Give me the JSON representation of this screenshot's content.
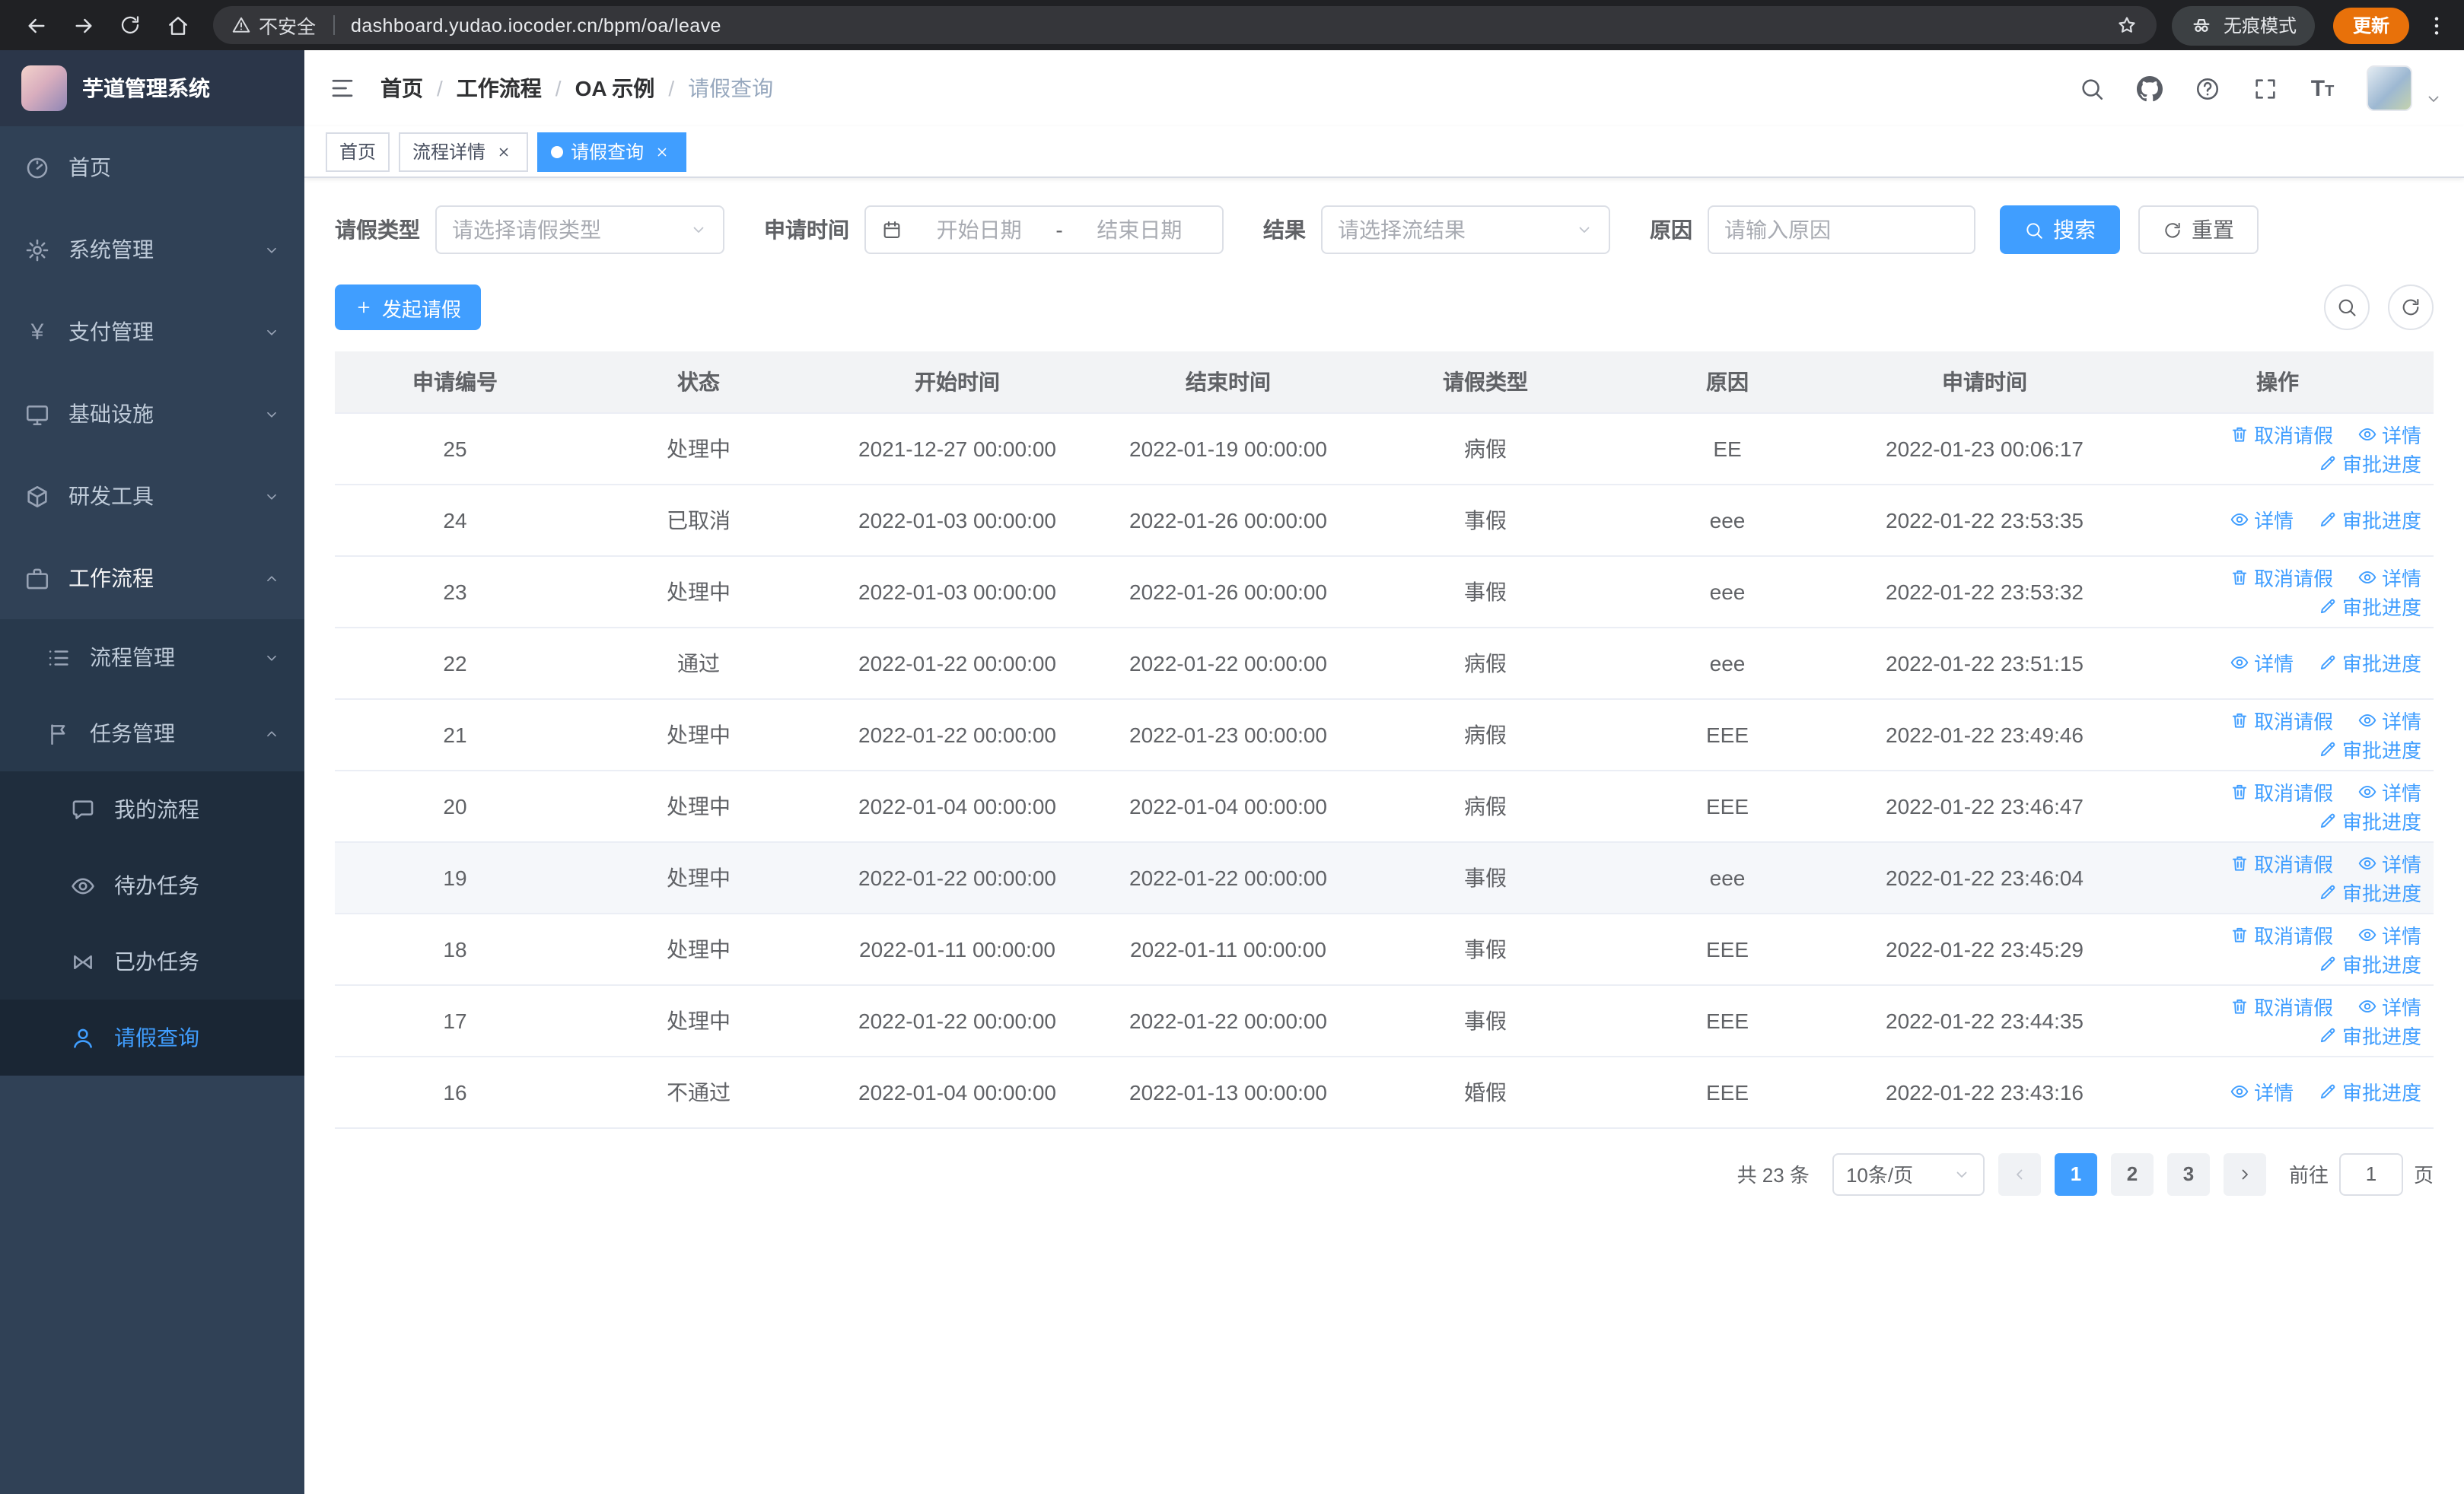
{
  "browser": {
    "security_label": "不安全",
    "url": "dashboard.yudao.iocoder.cn/bpm/oa/leave",
    "incognito_label": "无痕模式",
    "update_label": "更新"
  },
  "sidebar": {
    "title": "芋道管理系统",
    "top": [
      {
        "label": "首页"
      },
      {
        "label": "系统管理"
      },
      {
        "label": "支付管理"
      },
      {
        "label": "基础设施"
      },
      {
        "label": "研发工具"
      },
      {
        "label": "工作流程"
      }
    ],
    "workflow_children": [
      {
        "label": "流程管理"
      },
      {
        "label": "任务管理"
      }
    ],
    "task_children": [
      {
        "label": "我的流程"
      },
      {
        "label": "待办任务"
      },
      {
        "label": "已办任务"
      },
      {
        "label": "请假查询"
      }
    ]
  },
  "header": {
    "breadcrumb": [
      "首页",
      "工作流程",
      "OA 示例",
      "请假查询"
    ]
  },
  "tabs": [
    {
      "label": "首页",
      "closable": false,
      "active": false
    },
    {
      "label": "流程详情",
      "closable": true,
      "active": false
    },
    {
      "label": "请假查询",
      "closable": true,
      "active": true
    }
  ],
  "filters": {
    "leave_type_label": "请假类型",
    "leave_type_placeholder": "请选择请假类型",
    "apply_time_label": "申请时间",
    "start_date_placeholder": "开始日期",
    "range_separator": "-",
    "end_date_placeholder": "结束日期",
    "result_label": "结果",
    "result_placeholder": "请选择流结果",
    "reason_label": "原因",
    "reason_placeholder": "请输入原因",
    "search_button": "搜索",
    "reset_button": "重置"
  },
  "toolbar": {
    "create_button": "发起请假"
  },
  "table": {
    "columns": [
      "申请编号",
      "状态",
      "开始时间",
      "结束时间",
      "请假类型",
      "原因",
      "申请时间",
      "操作"
    ],
    "actions": {
      "cancel": "取消请假",
      "detail": "详情",
      "progress": "审批进度"
    },
    "rows": [
      {
        "id": "25",
        "status": "处理中",
        "start": "2021-12-27 00:00:00",
        "end": "2022-01-19 00:00:00",
        "type": "病假",
        "reason": "EE",
        "applied": "2022-01-23 00:06:17",
        "can_cancel": true,
        "hover": false
      },
      {
        "id": "24",
        "status": "已取消",
        "start": "2022-01-03 00:00:00",
        "end": "2022-01-26 00:00:00",
        "type": "事假",
        "reason": "eee",
        "applied": "2022-01-22 23:53:35",
        "can_cancel": false,
        "hover": false
      },
      {
        "id": "23",
        "status": "处理中",
        "start": "2022-01-03 00:00:00",
        "end": "2022-01-26 00:00:00",
        "type": "事假",
        "reason": "eee",
        "applied": "2022-01-22 23:53:32",
        "can_cancel": true,
        "hover": false
      },
      {
        "id": "22",
        "status": "通过",
        "start": "2022-01-22 00:00:00",
        "end": "2022-01-22 00:00:00",
        "type": "病假",
        "reason": "eee",
        "applied": "2022-01-22 23:51:15",
        "can_cancel": false,
        "hover": false
      },
      {
        "id": "21",
        "status": "处理中",
        "start": "2022-01-22 00:00:00",
        "end": "2022-01-23 00:00:00",
        "type": "病假",
        "reason": "EEE",
        "applied": "2022-01-22 23:49:46",
        "can_cancel": true,
        "hover": false
      },
      {
        "id": "20",
        "status": "处理中",
        "start": "2022-01-04 00:00:00",
        "end": "2022-01-04 00:00:00",
        "type": "病假",
        "reason": "EEE",
        "applied": "2022-01-22 23:46:47",
        "can_cancel": true,
        "hover": false
      },
      {
        "id": "19",
        "status": "处理中",
        "start": "2022-01-22 00:00:00",
        "end": "2022-01-22 00:00:00",
        "type": "事假",
        "reason": "eee",
        "applied": "2022-01-22 23:46:04",
        "can_cancel": true,
        "hover": true
      },
      {
        "id": "18",
        "status": "处理中",
        "start": "2022-01-11 00:00:00",
        "end": "2022-01-11 00:00:00",
        "type": "事假",
        "reason": "EEE",
        "applied": "2022-01-22 23:45:29",
        "can_cancel": true,
        "hover": false
      },
      {
        "id": "17",
        "status": "处理中",
        "start": "2022-01-22 00:00:00",
        "end": "2022-01-22 00:00:00",
        "type": "事假",
        "reason": "EEE",
        "applied": "2022-01-22 23:44:35",
        "can_cancel": true,
        "hover": false
      },
      {
        "id": "16",
        "status": "不通过",
        "start": "2022-01-04 00:00:00",
        "end": "2022-01-13 00:00:00",
        "type": "婚假",
        "reason": "EEE",
        "applied": "2022-01-22 23:43:16",
        "can_cancel": false,
        "hover": false
      }
    ]
  },
  "pagination": {
    "total": "共 23 条",
    "page_size": "10条/页",
    "pages": [
      "1",
      "2",
      "3"
    ],
    "active_page": "1",
    "goto_label": "前往",
    "goto_value": "1",
    "page_unit": "页"
  },
  "colors": {
    "primary": "#409eff",
    "sidebar_bg": "#304156",
    "update_pill": "#e8710a"
  },
  "icons": {
    "chrome": {
      "back": "arrow-left",
      "forward": "arrow-right",
      "reload": "circular-arrow",
      "home": "house",
      "not_secure": "warning-triangle",
      "bookmark": "star-outline",
      "incognito": "spy-glasses",
      "menu": "kebab-dots"
    },
    "navbar": {
      "search": "magnifier",
      "repo": "github-octocat",
      "help": "question-circle",
      "fullscreen": "expand-corners",
      "font_size": "double-T",
      "user": "avatar-photo"
    },
    "table_actions": {
      "cancel": "trash",
      "detail": "eye",
      "progress": "pen"
    }
  }
}
